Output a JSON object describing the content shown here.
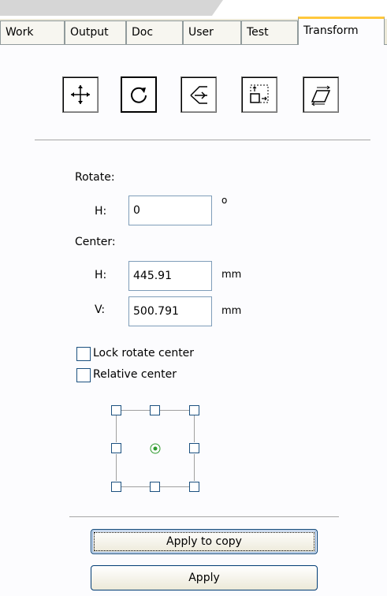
{
  "tabs": [
    {
      "label": "Work"
    },
    {
      "label": "Output"
    },
    {
      "label": "Doc"
    },
    {
      "label": "User"
    },
    {
      "label": "Test"
    },
    {
      "label": "Transform",
      "active": true
    }
  ],
  "tools": [
    {
      "icon": "move-icon",
      "active": false
    },
    {
      "icon": "rotate-icon",
      "active": true
    },
    {
      "icon": "mirror-icon",
      "active": false
    },
    {
      "icon": "scale-icon",
      "active": false
    },
    {
      "icon": "skew-icon",
      "active": false
    }
  ],
  "rotate": {
    "label": "Rotate:",
    "h_label": "H:",
    "h_value": "0",
    "unit": "o"
  },
  "center": {
    "label": "Center:",
    "h_label": "H:",
    "h_value": "445.91",
    "h_unit": "mm",
    "v_label": "V:",
    "v_value": "500.791",
    "v_unit": "mm"
  },
  "options": {
    "lock_rotate_center": "Lock rotate center",
    "relative_center": "Relative center",
    "selected_anchor": "center"
  },
  "buttons": {
    "apply_to_copy": "Apply to copy",
    "apply": "Apply"
  },
  "colors": {
    "active_tab_accent": "#ffc83c",
    "anchor_selected": "#2e9a2e"
  }
}
